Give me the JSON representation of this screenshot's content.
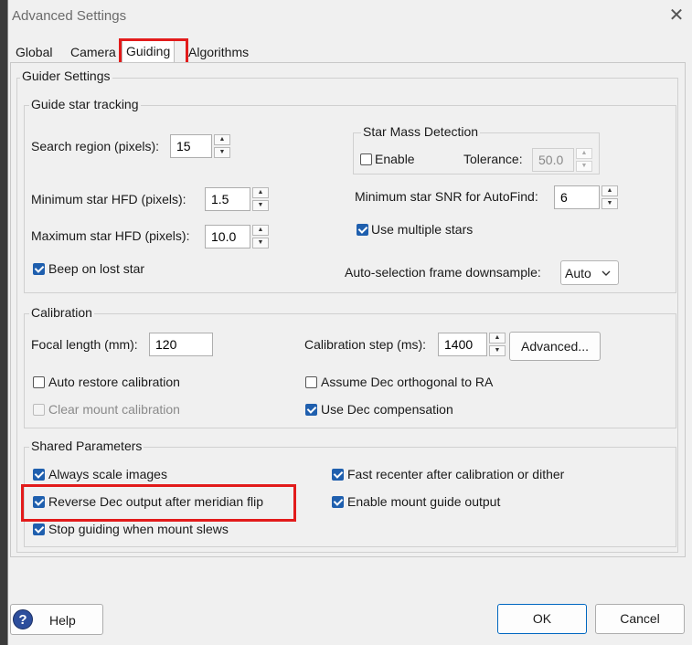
{
  "window": {
    "title": "Advanced Settings",
    "close_glyph": "✕"
  },
  "tabs": [
    {
      "label": "Global"
    },
    {
      "label": "Camera"
    },
    {
      "label": "Guiding"
    },
    {
      "label": "Algorithms"
    }
  ],
  "active_tab": "Guiding",
  "guider_settings": {
    "legend": "Guider Settings",
    "tracking": {
      "legend": "Guide star tracking",
      "search_region_label": "Search region (pixels):",
      "search_region_value": "15",
      "min_hfd_label": "Minimum star HFD (pixels):",
      "min_hfd_value": "1.5",
      "max_hfd_label": "Maximum star HFD (pixels):",
      "max_hfd_value": "10.0",
      "beep_label": "Beep on lost star",
      "beep_checked": true,
      "star_mass": {
        "legend": "Star Mass Detection",
        "enable_label": "Enable",
        "enable_checked": false,
        "tolerance_label": "Tolerance:",
        "tolerance_value": "50.0"
      },
      "min_snr_label": "Minimum star SNR for AutoFind:",
      "min_snr_value": "6",
      "multi_stars_label": "Use multiple stars",
      "multi_stars_checked": true,
      "downsample_label": "Auto-selection frame downsample:",
      "downsample_value": "Auto"
    },
    "calibration": {
      "legend": "Calibration",
      "focal_label": "Focal length (mm):",
      "focal_value": "120",
      "step_label": "Calibration step (ms):",
      "step_value": "1400",
      "advanced_label": "Advanced...",
      "auto_restore_label": "Auto restore calibration",
      "auto_restore_checked": false,
      "assume_dec_label": "Assume Dec orthogonal to RA",
      "assume_dec_checked": false,
      "clear_mount_label": "Clear mount calibration",
      "clear_mount_checked": false,
      "use_dec_comp_label": "Use Dec compensation",
      "use_dec_comp_checked": true
    },
    "shared": {
      "legend": "Shared Parameters",
      "always_scale_label": "Always scale images",
      "reverse_dec_label": "Reverse Dec output after meridian flip",
      "stop_guiding_label": "Stop guiding when mount slews",
      "fast_recenter_label": "Fast recenter after calibration or dither",
      "enable_mount_label": "Enable mount guide output"
    }
  },
  "buttons": {
    "help": "Help",
    "ok": "OK",
    "cancel": "Cancel"
  },
  "spin_glyphs": {
    "up": "▲",
    "down": "▼"
  },
  "colors": {
    "highlight": "#e21b1b",
    "checkbox_accent": "#1f5fae",
    "ok_border": "#0067c0"
  }
}
